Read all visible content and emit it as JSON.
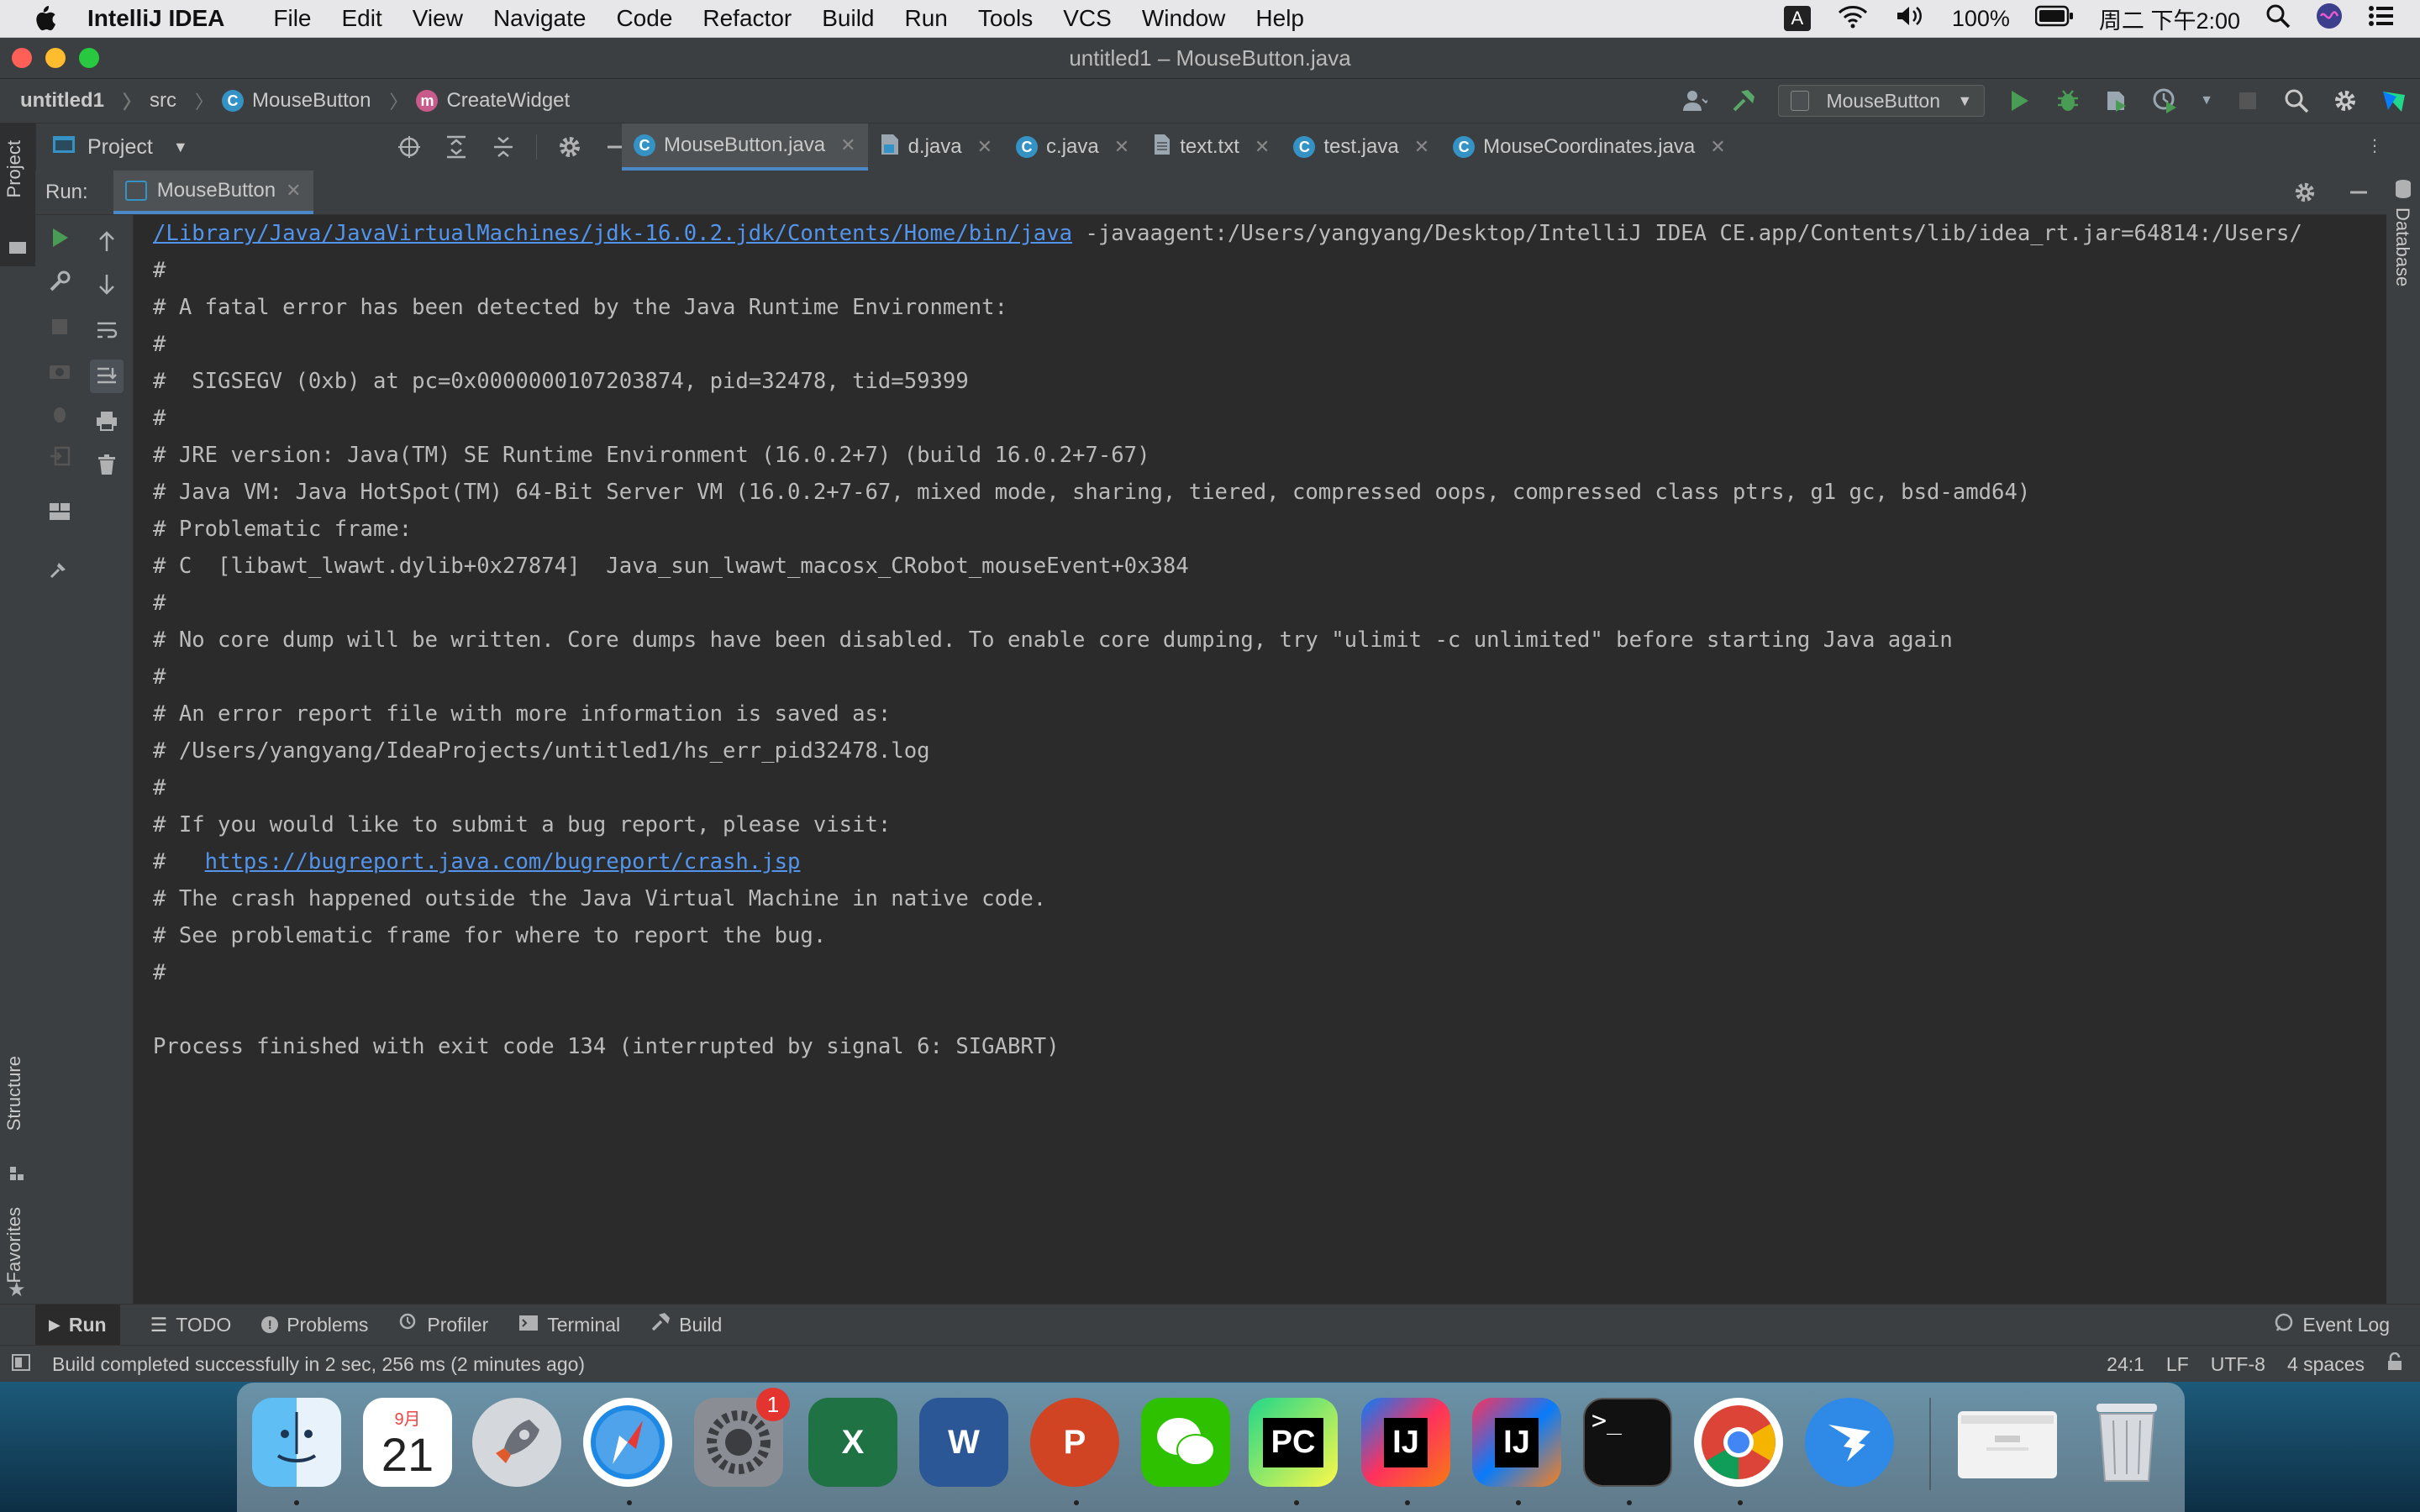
{
  "menubar": {
    "app": "IntelliJ IDEA",
    "items": [
      "File",
      "Edit",
      "View",
      "Navigate",
      "Code",
      "Refactor",
      "Build",
      "Run",
      "Tools",
      "VCS",
      "Window",
      "Help"
    ],
    "input_indicator": "A",
    "battery": "100%",
    "clock": "周二 下午2:00"
  },
  "window": {
    "title": "untitled1 – MouseButton.java"
  },
  "navbar": {
    "crumbs": [
      "untitled1",
      "src",
      "MouseButton",
      "CreateWidget"
    ],
    "run_config": "MouseButton"
  },
  "project_panel": {
    "label": "Project"
  },
  "editor_tabs": [
    "MouseButton.java",
    "d.java",
    "c.java",
    "text.txt",
    "test.java",
    "MouseCoordinates.java"
  ],
  "side_labels": {
    "project": "Project",
    "structure": "Structure",
    "favorites": "Favorites",
    "database": "Database"
  },
  "run_panel": {
    "label": "Run:",
    "tab": "MouseButton"
  },
  "console": {
    "java_path": "/Library/Java/JavaVirtualMachines/jdk-16.0.2.jdk/Contents/Home/bin/java",
    "java_args": " -javaagent:/Users/yangyang/Desktop/IntelliJ IDEA CE.app/Contents/lib/idea_rt.jar=64814:/Users/",
    "lines": [
      "#",
      "# A fatal error has been detected by the Java Runtime Environment:",
      "#",
      "#  SIGSEGV (0xb) at pc=0x0000000107203874, pid=32478, tid=59399",
      "#",
      "# JRE version: Java(TM) SE Runtime Environment (16.0.2+7) (build 16.0.2+7-67)",
      "# Java VM: Java HotSpot(TM) 64-Bit Server VM (16.0.2+7-67, mixed mode, sharing, tiered, compressed oops, compressed class ptrs, g1 gc, bsd-amd64)",
      "# Problematic frame:",
      "# C  [libawt_lwawt.dylib+0x27874]  Java_sun_lwawt_macosx_CRobot_mouseEvent+0x384",
      "#",
      "# No core dump will be written. Core dumps have been disabled. To enable core dumping, try \"ulimit -c unlimited\" before starting Java again",
      "#",
      "# An error report file with more information is saved as:",
      "# /Users/yangyang/IdeaProjects/untitled1/hs_err_pid32478.log",
      "#",
      "# If you would like to submit a bug report, please visit:"
    ],
    "bug_prefix": "#   ",
    "bug_url": "https://bugreport.java.com/bugreport/crash.jsp",
    "tail_lines": [
      "# The crash happened outside the Java Virtual Machine in native code.",
      "# See problematic frame for where to report the bug.",
      "#"
    ],
    "exit": "Process finished with exit code 134 (interrupted by signal 6: SIGABRT)"
  },
  "bottom_tools": [
    "Run",
    "TODO",
    "Problems",
    "Profiler",
    "Terminal",
    "Build"
  ],
  "event_log": "Event Log",
  "status": {
    "message": "Build completed successfully in 2 sec, 256 ms (2 minutes ago)",
    "position": "24:1",
    "line_sep": "LF",
    "encoding": "UTF-8",
    "indent": "4 spaces"
  },
  "dock": {
    "calendar_month": "9月",
    "calendar_day": "21",
    "prefs_badge": "1",
    "excel": "X",
    "word": "W",
    "ppt": "P",
    "pycharm": "PC",
    "idea1": "IJ",
    "idea2": "IJ",
    "terminal": ">_"
  },
  "colors": {
    "console_bg": "#2b2b2b",
    "panel_bg": "#3c3f41",
    "link": "#5394ec",
    "accent": "#4a88c7"
  }
}
